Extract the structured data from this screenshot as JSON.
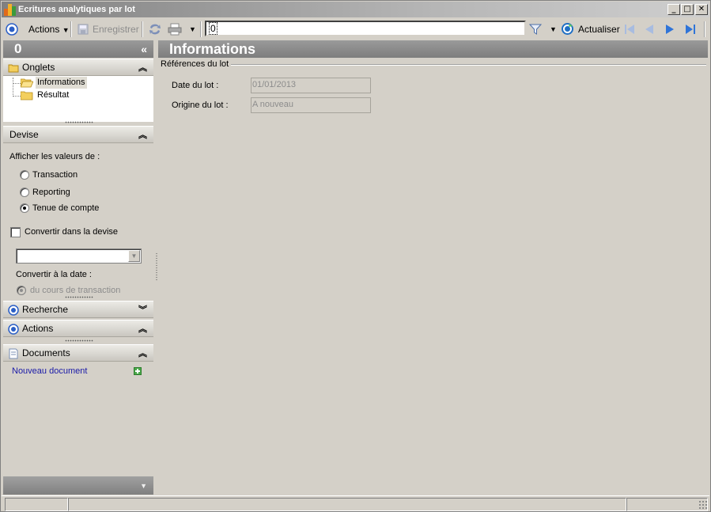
{
  "window": {
    "title": "Ecritures analytiques par lot"
  },
  "toolbar": {
    "actions_label": "Actions",
    "save_label": "Enregistrer",
    "search_value": "0",
    "refresh_label": "Actualiser"
  },
  "left_panel": {
    "count": "0",
    "collapse_glyph": "«",
    "tabs_section": {
      "title": "Onglets",
      "items": [
        {
          "label": "Informations"
        },
        {
          "label": "Résultat"
        }
      ]
    },
    "devise_section": {
      "title": "Devise",
      "show_values_label": "Afficher les valeurs de :",
      "options": [
        {
          "label": "Transaction"
        },
        {
          "label": "Reporting"
        },
        {
          "label": "Tenue de compte"
        }
      ],
      "selected_option": "Tenue de compte",
      "convert_label": "Convertir dans la devise",
      "convert_date_label": "Convertir à la date :",
      "rate_option": "du cours de transaction"
    },
    "search_section": {
      "title": "Recherche"
    },
    "actions_section": {
      "title": "Actions"
    },
    "documents_section": {
      "title": "Documents",
      "new_document_label": "Nouveau document"
    }
  },
  "main": {
    "title": "Informations",
    "group_title": "Références du lot",
    "fields": [
      {
        "label": "Date du lot :",
        "value": "01/01/2013"
      },
      {
        "label": "Origine du lot :",
        "value": "A nouveau"
      }
    ]
  },
  "colors": {
    "window_bg": "#d4d0c8",
    "header_gray": "#8a8a8a",
    "link_blue": "#1a1aa8",
    "accent_blue": "#2b5fc6"
  },
  "icons": [
    "app-icon",
    "actions-circle-icon",
    "save-icon",
    "sync-icon",
    "print-icon",
    "filter-icon",
    "refresh-icon",
    "first-record-icon",
    "previous-record-icon",
    "next-record-icon",
    "last-record-icon",
    "folder-icon",
    "document-icon",
    "add-icon"
  ]
}
